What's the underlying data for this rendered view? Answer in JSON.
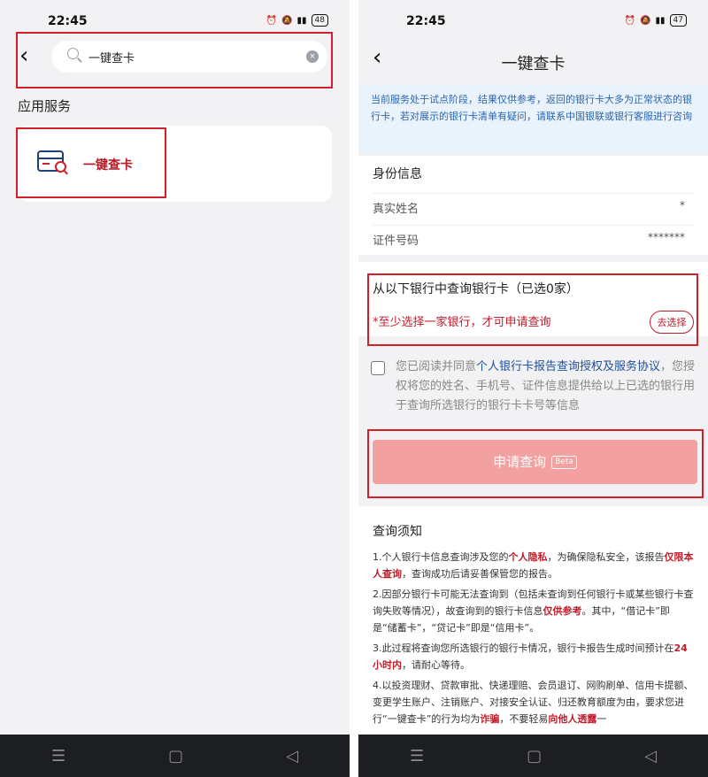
{
  "status": {
    "time": "22:45",
    "battery_left": "48",
    "battery_right": "47",
    "icons": [
      "alarm-icon",
      "mute-icon",
      "s-app-icon",
      "hd-icon",
      "5g-signal-icon",
      "4g-signal-icon",
      "battery-icon"
    ]
  },
  "nav": {
    "menu": "☰",
    "home": "▢",
    "back": "◁"
  },
  "left": {
    "search": {
      "value": "一键查卡",
      "clear": "×"
    },
    "section_title": "应用服务",
    "service": {
      "label": "一键查卡",
      "icon": "card-search-icon"
    }
  },
  "right": {
    "title": "一键查卡",
    "notice": "当前服务处于试点阶段，结果仅供参考，返回的银行卡大多为正常状态的银行卡，若对展示的银行卡清单有疑问，请联系中国银联或银行客服进行咨询",
    "identity": {
      "title": "身份信息",
      "name_label": "真实姓名",
      "name_value": "*",
      "id_label": "证件号码",
      "id_value": "*******"
    },
    "bank": {
      "title": "从以下银行中查询银行卡（已选0家）",
      "warning": "*至少选择一家银行，才可申请查询",
      "choose": "去选择"
    },
    "agreement": {
      "prefix": "您已阅读并同意",
      "link": "个人银行卡报告查询授权及服务协议",
      "suffix": "，您授权将您的姓名、手机号、证件信息提供给以上已选的银行用于查询所选银行的银行卡卡号等信息"
    },
    "apply": {
      "label": "申请查询",
      "badge": "Beta"
    },
    "rules": {
      "title": "查询须知",
      "r1a": "1.个人银行卡信息查询涉及您的",
      "r1b": "个人隐私",
      "r1c": "，为确保隐私安全，该报告",
      "r1d": "仅限本人查询",
      "r1e": "，查询成功后请妥善保管您的报告。",
      "r2a": "2.因部分银行卡可能无法查询到（包括未查询到任何银行卡或某些银行卡查询失败等情况），故查询到的银行卡信息",
      "r2b": "仅供参考",
      "r2c": "。其中，“借记卡”即是“储蓄卡”，“贷记卡”即是“信用卡”。",
      "r3a": "3.此过程将查询您所选银行的银行卡情况，银行卡报告生成时间预计在",
      "r3b": "24小时内",
      "r3c": "，请耐心等待。",
      "r4a": "4.以投资理财、贷款审批、快递理赔、会员退订、网购刷单、信用卡提额、变更学生账户、注销账户、对接安全认证、归还教育额度为由，要求您进行“一键查卡”的行为均为",
      "r4b": "诈骗",
      "r4c": "，不要轻易",
      "r4d": "向他人透露",
      "r4e": "一"
    }
  }
}
